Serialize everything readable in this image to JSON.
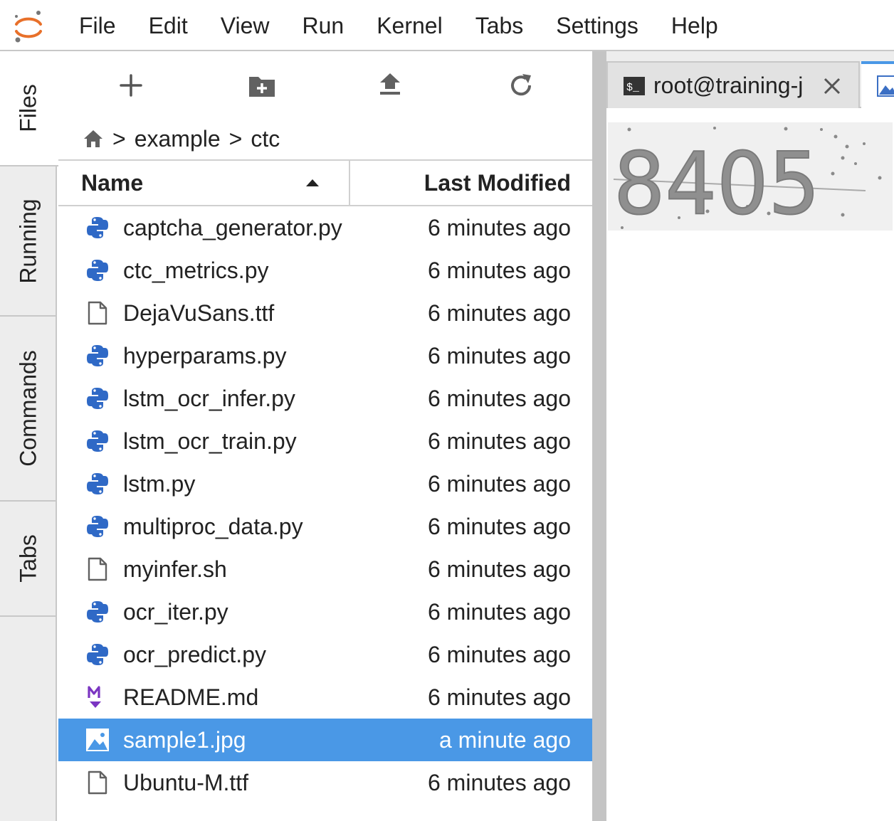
{
  "menu": [
    "File",
    "Edit",
    "View",
    "Run",
    "Kernel",
    "Tabs",
    "Settings",
    "Help"
  ],
  "sidebar_tabs": [
    "Files",
    "Running",
    "Commands",
    "Tabs"
  ],
  "toolbar": {
    "new_launcher_icon": "plus-icon",
    "new_folder_icon": "new-folder-icon",
    "upload_icon": "upload-icon",
    "refresh_icon": "refresh-icon"
  },
  "breadcrumb": {
    "home_icon": "home-icon",
    "sep1": ">",
    "folder1": "example",
    "sep2": ">",
    "folder2": "ctc"
  },
  "file_list": {
    "header_name": "Name",
    "header_modified": "Last Modified",
    "sort_direction": "ascending",
    "rows": [
      {
        "icon": "python-icon",
        "name": "captcha_generator.py",
        "modified": "6 minutes ago",
        "selected": false
      },
      {
        "icon": "python-icon",
        "name": "ctc_metrics.py",
        "modified": "6 minutes ago",
        "selected": false
      },
      {
        "icon": "file-icon",
        "name": "DejaVuSans.ttf",
        "modified": "6 minutes ago",
        "selected": false
      },
      {
        "icon": "python-icon",
        "name": "hyperparams.py",
        "modified": "6 minutes ago",
        "selected": false
      },
      {
        "icon": "python-icon",
        "name": "lstm_ocr_infer.py",
        "modified": "6 minutes ago",
        "selected": false
      },
      {
        "icon": "python-icon",
        "name": "lstm_ocr_train.py",
        "modified": "6 minutes ago",
        "selected": false
      },
      {
        "icon": "python-icon",
        "name": "lstm.py",
        "modified": "6 minutes ago",
        "selected": false
      },
      {
        "icon": "python-icon",
        "name": "multiproc_data.py",
        "modified": "6 minutes ago",
        "selected": false
      },
      {
        "icon": "file-icon",
        "name": "myinfer.sh",
        "modified": "6 minutes ago",
        "selected": false
      },
      {
        "icon": "python-icon",
        "name": "ocr_iter.py",
        "modified": "6 minutes ago",
        "selected": false
      },
      {
        "icon": "python-icon",
        "name": "ocr_predict.py",
        "modified": "6 minutes ago",
        "selected": false
      },
      {
        "icon": "markdown-icon",
        "name": "README.md",
        "modified": "6 minutes ago",
        "selected": false
      },
      {
        "icon": "image-icon",
        "name": "sample1.jpg",
        "modified": "a minute ago",
        "selected": true
      },
      {
        "icon": "file-icon",
        "name": "Ubuntu-M.ttf",
        "modified": "6 minutes ago",
        "selected": false
      }
    ]
  },
  "document_tabs": [
    {
      "icon": "terminal-icon",
      "label": "root@training-j",
      "closable": true
    },
    {
      "icon": "image-icon",
      "label": "",
      "active": true
    }
  ],
  "viewer": {
    "image_text": "8405"
  },
  "colors": {
    "selection": "#4a98e6",
    "python_blue": "#2f69c6",
    "markdown_purple": "#7b35c2",
    "logo_orange": "#e8702a"
  }
}
